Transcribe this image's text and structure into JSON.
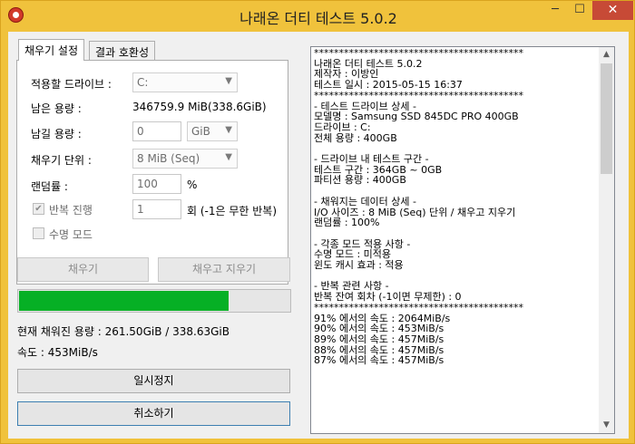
{
  "window": {
    "title": "나래온 더티 테스트 5.0.2",
    "controls": {
      "minimize": "─",
      "maximize": "☐",
      "close": "✕"
    }
  },
  "tabs": [
    {
      "label": "채우기 설정",
      "active": true
    },
    {
      "label": "결과 호환성",
      "active": false
    }
  ],
  "settings": {
    "drive_label": "적용할 드라이브 :",
    "drive_value": "C:",
    "free_label": "남은 용량 :",
    "free_value": "346759.9 MiB(338.6GiB)",
    "leave_label": "남길 용량 :",
    "leave_value": "0",
    "leave_unit": "GiB",
    "unit_label": "채우기 단위 :",
    "unit_value": "8 MiB (Seq)",
    "random_label": "랜덤률 :",
    "random_value": "100",
    "random_unit": "%",
    "repeat_label": "반복 진행",
    "repeat_value": "1",
    "repeat_hint": "회 (-1은 무한 반복)",
    "life_label": "수명 모드"
  },
  "buttons": {
    "fill": "채우기",
    "fill_erase": "채우고 지우기",
    "pause": "일시정지",
    "cancel": "취소하기"
  },
  "progress": {
    "fraction": 0.77
  },
  "status": {
    "filled": "현재 채워진 용량 : 261.50GiB / 338.63GiB",
    "speed": "속도 : 453MiB/s"
  },
  "log": [
    "******************************************",
    "나래온 더티 테스트 5.0.2",
    "제작자 : 이방인",
    "테스트 일시 : 2015-05-15 16:37",
    "******************************************",
    "- 테스트 드라이브 상세 -",
    "모델명 : Samsung SSD 845DC PRO 400GB",
    "드라이브 : C:",
    "전체 용량 : 400GB",
    "",
    "- 드라이브 내 테스트 구간 -",
    "테스트 구간 : 364GB ~ 0GB",
    "파티션 용량 : 400GB",
    "",
    "- 채워지는 데이터 상세 -",
    "I/O 사이즈 : 8 MiB (Seq) 단위 / 채우고 지우기",
    "랜덤률 : 100%",
    "",
    "- 각종 모드 적용 사항 -",
    "수명 모드 : 미적용",
    "윈도 캐시 효과 : 적용",
    "",
    "- 반복 관련 사항 -",
    "반복 잔여 회차 (-1이면 무제한) : 0",
    "******************************************",
    "91% 에서의 속도 : 2064MiB/s",
    "90% 에서의 속도 : 453MiB/s",
    "89% 에서의 속도 : 457MiB/s",
    "88% 에서의 속도 : 457MiB/s",
    "87% 에서의 속도 : 457MiB/s"
  ],
  "colors": {
    "progress": "#06b025",
    "frame": "#f0c23c",
    "close": "#c74a36"
  }
}
